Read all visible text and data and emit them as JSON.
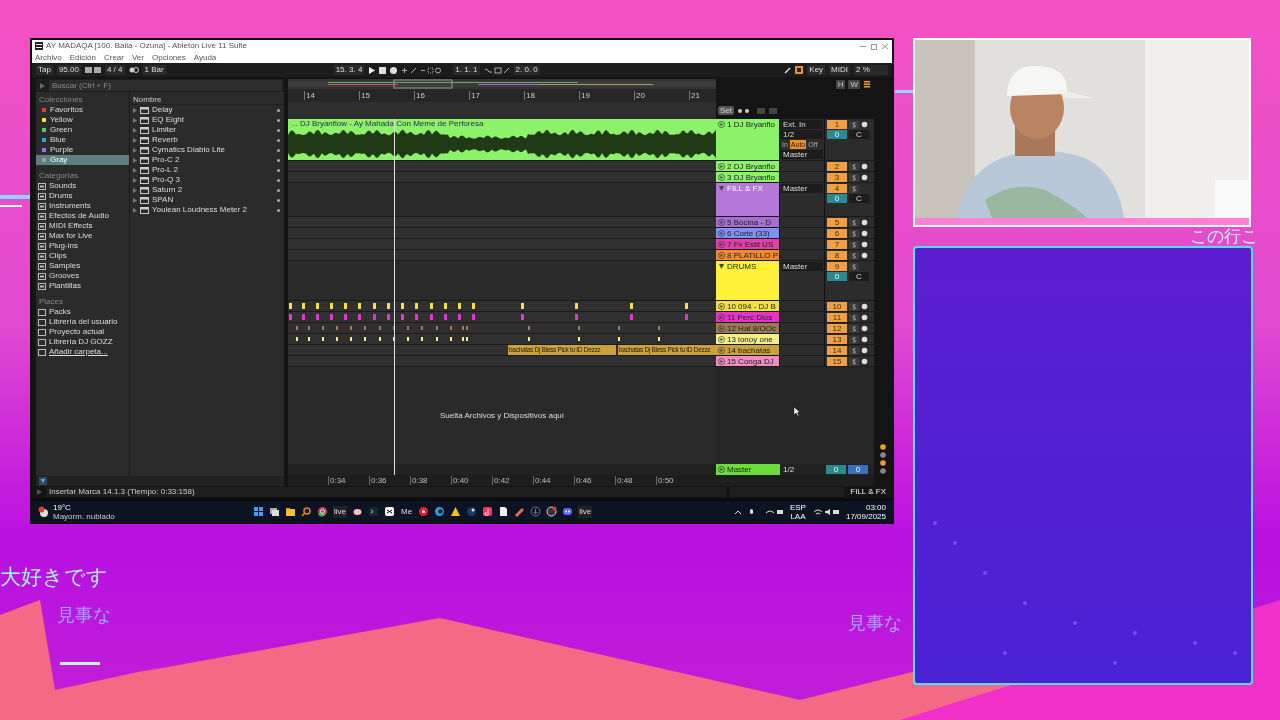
{
  "overlay_texts": [
    "この行こ",
    "大好きです",
    "見事な",
    "見事な"
  ],
  "window": {
    "title": "AY MADAQA [100. Baila - Ozuna] - Ableton Live 11 Suite"
  },
  "menu": [
    "Archivo",
    "Edición",
    "Crear",
    "Ver",
    "Opciones",
    "Ayuda"
  ],
  "toolbar": {
    "tap": "Tap",
    "tempo": "95.00",
    "signature": "4 / 4",
    "quantize": "1 Bar",
    "position": "15. 3. 4",
    "loop_start": "1. 1. 1",
    "loop_length": "2. 0. 0",
    "key": "Key",
    "midi": "MIDI",
    "cpu": "2 %"
  },
  "browser": {
    "search": {
      "placeholder": "Buscar (Ctrl + F)"
    },
    "collections_header": "Colecciones",
    "collections": [
      {
        "label": "Favoritos",
        "color": "#e53935",
        "selected": false
      },
      {
        "label": "Yellow",
        "color": "#f0e040",
        "selected": false
      },
      {
        "label": "Green",
        "color": "#4ccf6a",
        "selected": false
      },
      {
        "label": "Blue",
        "color": "#3aa0d8",
        "selected": false
      },
      {
        "label": "Purple",
        "color": "#a070e0",
        "selected": false
      },
      {
        "label": "Gray",
        "color": "#9aa0a0",
        "selected": true
      }
    ],
    "categories_header": "Categorías",
    "categories": [
      "Sounds",
      "Drums",
      "Instruments",
      "Efectos de Audio",
      "MIDI Effects",
      "Max for Live",
      "Plug-ins",
      "Clips",
      "Samples",
      "Grooves",
      "Plantillas"
    ],
    "places_header": "Places",
    "places": [
      "Packs",
      "Librería del usuario",
      "Proyecto actual",
      "Librería DJ GOZZ",
      "Añadir carpeta..."
    ],
    "name_header": "Nombre",
    "items": [
      "Delay",
      "EQ Eight",
      "Limiter",
      "Reverb",
      "Cymatics Diablo Lite",
      "Pro-C 2",
      "Pro-L 2",
      "Pro-Q 3",
      "Saturn 2",
      "SPAN",
      "Youlean Loudness Meter 2"
    ]
  },
  "arrangement": {
    "overview_buttons": [
      "H",
      "W"
    ],
    "set_button": "Set",
    "ruler": [
      "14",
      "15",
      "16",
      "17",
      "18",
      "19",
      "20",
      "21"
    ],
    "time_ruler": [
      "0:34",
      "0:36",
      "0:38",
      "0:40",
      "0:42",
      "0:44",
      "0:46",
      "0:48",
      "0:50"
    ],
    "drop_hint": "Suelta Archivos y Dispositivos aquí",
    "tracks": [
      {
        "kind": "audio",
        "expanded": true,
        "name": "1 DJ Bryanflo",
        "color": "#8cf26a",
        "number": "1",
        "input": "Ext. In",
        "channel": "1/2",
        "monitor": [
          {
            "label": "In",
            "selected": false
          },
          {
            "label": "Auto",
            "selected": true
          },
          {
            "label": "Off",
            "selected": false
          }
        ],
        "output": "Master",
        "volume": "0",
        "pan": "C",
        "clips": [
          {
            "label": "... DJ Bryanflow - Ay Mahada Con Meme de Perforesa"
          }
        ]
      },
      {
        "kind": "audio",
        "expanded": false,
        "name": "2 DJ Bryanflo",
        "color": "#8cf26a",
        "number": "2"
      },
      {
        "kind": "audio",
        "expanded": false,
        "name": "3 DJ Bryanflo",
        "color": "#8cf26a",
        "number": "3"
      },
      {
        "kind": "group",
        "expanded": true,
        "name": "FILL & FX",
        "color": "#b478d8",
        "number": "4",
        "output": "Master",
        "volume": "0",
        "pan": "C"
      },
      {
        "kind": "midi",
        "expanded": false,
        "name": "5 Bocina - D",
        "color": "#a66fd0",
        "number": "5"
      },
      {
        "kind": "midi",
        "expanded": false,
        "name": "6 Corte (33)",
        "color": "#7f90f0",
        "number": "6"
      },
      {
        "kind": "midi",
        "expanded": false,
        "name": "7 Fx Estil US",
        "color": "#e040a8",
        "number": "7"
      },
      {
        "kind": "midi",
        "expanded": false,
        "name": "8 PLATILLO P",
        "color": "#f08a2c",
        "number": "8"
      },
      {
        "kind": "group",
        "expanded": true,
        "name": "DRUMS",
        "color": "#fff13a",
        "number": "9",
        "output": "Master",
        "volume": "0",
        "pan": "C"
      },
      {
        "kind": "hits",
        "expanded": false,
        "name": "10 094 - DJ B",
        "color": "#f0e040",
        "number": "10"
      },
      {
        "kind": "hits",
        "expanded": false,
        "name": "11 Perc Dios",
        "color": "#e535c8",
        "number": "11"
      },
      {
        "kind": "ticks",
        "expanded": false,
        "name": "12 Hat 8/OOc",
        "color": "#9a7a50",
        "number": "12"
      },
      {
        "kind": "ticks",
        "expanded": false,
        "name": "13 lonoy one",
        "color": "#f5ef8a",
        "number": "13"
      },
      {
        "kind": "midi",
        "expanded": false,
        "name": "14 bachatas",
        "color": "#c9a23a",
        "number": "14",
        "clips": [
          {
            "label": "bachatas Dj Bless Pick tu ID Dezzz"
          },
          {
            "label": "bachatas Dj Bless Pick tu ID Dezzz"
          }
        ]
      },
      {
        "kind": "midi",
        "expanded": false,
        "name": "15 Conga DJ",
        "color": "#f08cc0",
        "number": "15"
      }
    ],
    "master": {
      "name": "Master",
      "color": "#6ddc3a",
      "channel": "1/2",
      "volume": "0",
      "pan": "0"
    }
  },
  "status_bar": {
    "message": "Insertar Marca 14.1.3 (Tiempo: 0:33:158)",
    "track": "FILL & FX"
  },
  "taskbar": {
    "weather": {
      "temperature": "19°C",
      "condition": "Mayorm. nublado"
    },
    "apps": [
      {
        "kind": "windows"
      },
      {
        "kind": "taskview"
      },
      {
        "kind": "folder"
      },
      {
        "kind": "search"
      },
      {
        "kind": "chrome"
      },
      {
        "kind": "live",
        "label": "live"
      },
      {
        "kind": "round"
      },
      {
        "kind": "terminal"
      },
      {
        "kind": "capcut"
      },
      {
        "kind": "text",
        "label": "Me"
      },
      {
        "kind": "record"
      },
      {
        "kind": "cbrowser"
      },
      {
        "kind": "warning"
      },
      {
        "kind": "steam"
      },
      {
        "kind": "tiktok"
      },
      {
        "kind": "file"
      },
      {
        "kind": "tool"
      },
      {
        "kind": "download"
      },
      {
        "kind": "obs"
      },
      {
        "kind": "discord"
      },
      {
        "kind": "live",
        "label": "live"
      }
    ],
    "language": "ESP",
    "layout": "LAA",
    "time": "03:00",
    "date": "17/09/2025"
  }
}
